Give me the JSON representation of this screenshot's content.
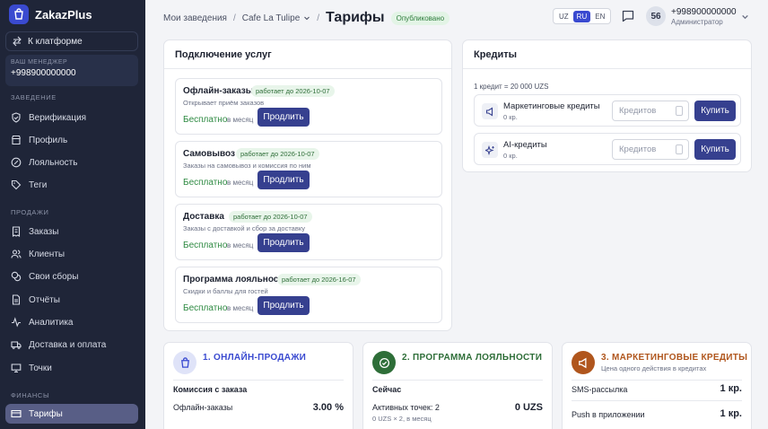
{
  "app": {
    "name": "ZakazPlus"
  },
  "sidebar": {
    "back_label": "К клатформе",
    "manager_label": "ВАШ МЕНЕДЖЕР",
    "manager_phone": "+998900000000",
    "section_venue": "ЗАВЕДЕНИЕ",
    "section_sales": "ПРОДАЖИ",
    "section_finance": "ФИНАНСЫ",
    "venue_items": [
      "Верификация",
      "Профиль",
      "Лояльность",
      "Теги"
    ],
    "sales_items": [
      "Заказы",
      "Клиенты",
      "Свои сборы",
      "Отчёты",
      "Аналитика",
      "Доставка и оплата",
      "Точки"
    ],
    "finance_items": [
      "Тарифы"
    ]
  },
  "header": {
    "crumb_1": "Мои заведения",
    "crumb_2": "Cafe La Tulipe",
    "sep": "/",
    "title": "Тарифы",
    "status": "Опубликовано",
    "langs": [
      "UZ",
      "RU",
      "EN"
    ],
    "active_lang": "RU",
    "avatar": "56",
    "user_phone": "+998900000000",
    "user_role": "Администратор"
  },
  "services": {
    "title": "Подключение услуг",
    "free_label": "Бесплатно",
    "period_label": "в месяц",
    "renew_label": "Продлить",
    "items": [
      {
        "name": "Офлайн-заказы",
        "badge": "работает до 2026-10-07",
        "desc": "Открывает приём заказов"
      },
      {
        "name": "Самовывоз",
        "badge": "работает до 2026-10-07",
        "desc": "Заказы на самовывоз и комиссия по ним"
      },
      {
        "name": "Доставка",
        "badge": "работает до 2026-10-07",
        "desc": "Заказы с доставкой и сбор за доставку"
      },
      {
        "name": "Программа лояльности",
        "badge": "работает до 2026-16-07",
        "desc": "Скидки и баллы для гостей"
      }
    ]
  },
  "credits": {
    "title": "Кредиты",
    "rate": "1 кредит = 20 000 UZS",
    "input_placeholder": "Кредитов",
    "buy_label": "Купить",
    "items": [
      {
        "name": "Маркетинговые кредиты",
        "amount": "0 кр."
      },
      {
        "name": "AI-кредиты",
        "amount": "0 кр."
      }
    ]
  },
  "blocks": {
    "online": {
      "title": "1. ОНЛАЙН-ПРОДАЖИ",
      "heading": "Комиссия с заказа",
      "row_label": "Офлайн-заказы",
      "row_value": "3.00 %"
    },
    "loyalty": {
      "title": "2. ПРОГРАММА ЛОЯЛЬНОСТИ",
      "heading": "Сейчас",
      "row_label": "Активных точек: 2",
      "row_sub": "0 UZS × 2, в месяц",
      "row_value": "0 UZS"
    },
    "marketing": {
      "title": "3. МАРКЕТИНГОВЫЕ КРЕДИТЫ",
      "subtitle": "Цена одного действия в кредитах",
      "rows": [
        {
          "label": "SMS-рассылка",
          "value": "1 кр."
        },
        {
          "label": "Push в приложении",
          "value": "1 кр."
        }
      ]
    }
  },
  "colors": {
    "sidebar_bg": "#1f2538",
    "accent": "#36408f",
    "free_green": "#2e8a42",
    "online_accent": "#3a4ad0",
    "loyalty_accent": "#2e6e38",
    "marketing_accent": "#b0561d"
  }
}
